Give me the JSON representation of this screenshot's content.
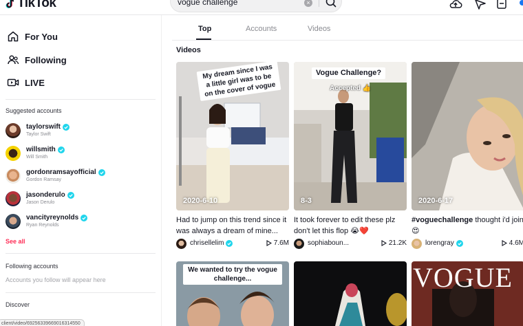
{
  "app": {
    "name": "TikTok"
  },
  "search": {
    "query": "vogue challenge",
    "clear_glyph": "×"
  },
  "icons": [
    "upload-icon",
    "send-icon",
    "inbox-icon"
  ],
  "colors": {
    "brand": "#fe2c55",
    "verified": "#20d5ec",
    "text": "#161823",
    "muted": "#8a8b91"
  },
  "nav": [
    {
      "label": "For You",
      "icon": "home-icon"
    },
    {
      "label": "Following",
      "icon": "people-icon"
    },
    {
      "label": "LIVE",
      "icon": "live-icon"
    }
  ],
  "sidebar": {
    "suggested_label": "Suggested accounts",
    "see_all": "See all",
    "following_label": "Following accounts",
    "following_hint": "Accounts you follow will appear here",
    "discover_label": "Discover",
    "url_preview": "client/video/69256339669016314550"
  },
  "suggested": [
    {
      "username": "taylorswift",
      "name": "Taylor Swift",
      "verified": true
    },
    {
      "username": "willsmith",
      "name": "Will Smith",
      "verified": true
    },
    {
      "username": "gordonramsayofficial",
      "name": "Gordon Ramsay",
      "verified": true
    },
    {
      "username": "jasonderulo",
      "name": "Jason Derulo",
      "verified": true
    },
    {
      "username": "vancityreynolds",
      "name": "Ryan Reynolds",
      "verified": true
    }
  ],
  "tabs": [
    {
      "label": "Top",
      "active": true
    },
    {
      "label": "Accounts",
      "active": false
    },
    {
      "label": "Videos",
      "active": false
    }
  ],
  "section_title": "Videos",
  "videos": [
    {
      "date": "2020-6-10",
      "overlay": "My dream since I was a little girl was to be on the cover of vogue",
      "caption": "Had to jump on this trend since it was always a dream of mine...",
      "author": "chrisellelim",
      "verified": true,
      "views": "7.6M"
    },
    {
      "date": "8-3",
      "overlay": "Vogue Challenge?",
      "overlay2": "Accepted 👍",
      "caption": "It took forever to edit these plz don't let this flop 😭❤️",
      "author": "sophiaboun...",
      "verified": false,
      "views": "21.2K"
    },
    {
      "date": "2020-6-17",
      "overlay": "",
      "caption_tag": "#voguechallenge",
      "caption": " thought i'd join",
      "author": "lorengray",
      "verified": true,
      "views": "4.6M"
    },
    {
      "overlay": "We wanted to try the vogue challenge..."
    },
    {
      "overlay": ""
    },
    {
      "overlay": "VOGUE"
    }
  ]
}
